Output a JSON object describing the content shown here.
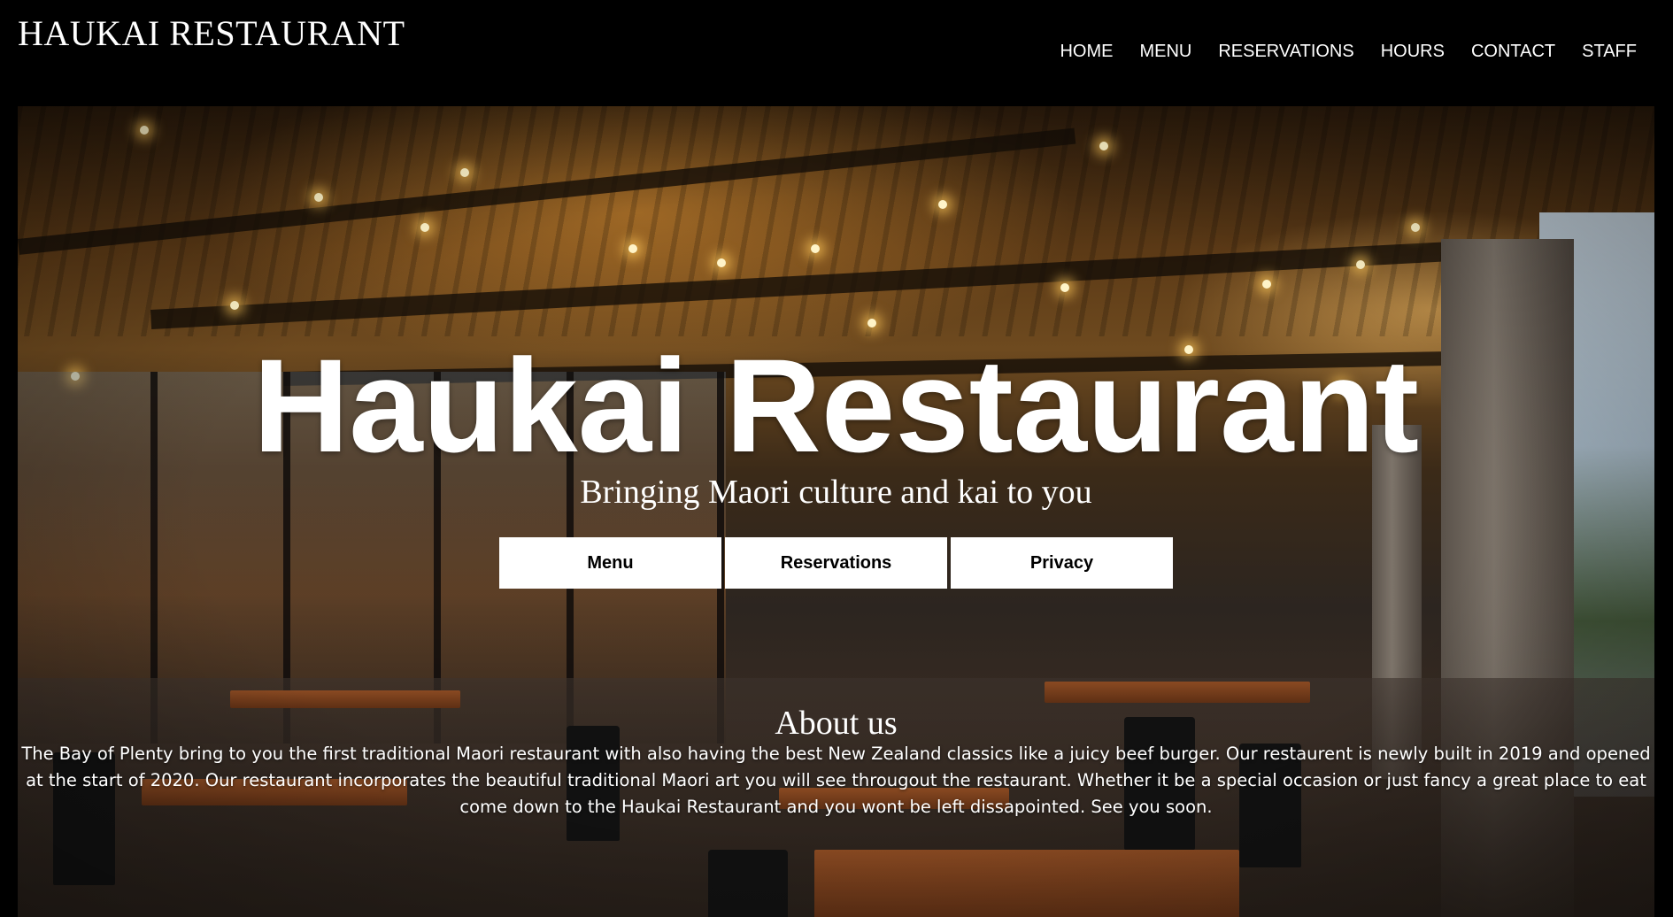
{
  "header": {
    "brand": "HAUKAI RESTAURANT",
    "nav": [
      "HOME",
      "MENU",
      "RESERVATIONS",
      "HOURS",
      "CONTACT",
      "STAFF"
    ]
  },
  "hero": {
    "title": "Haukai Restaurant",
    "subtitle": "Bringing Maori culture and kai to you",
    "buttons": [
      "Menu",
      "Reservations",
      "Privacy"
    ]
  },
  "about": {
    "title": "About us",
    "text": "The Bay of Plenty bring to you the first traditional Maori restaurant with also having the best New Zealand classics like a juicy beef burger. Our restaurent is newly built in 2019 and opened at the start of 2020. Our restaurant incorporates the beautiful traditional Maori art you will see througout the restaurant. Whether it be a special occasion or just fancy a great place to eat come down to the Haukai Restaurant and you wont be left dissapointed. See you soon."
  },
  "colors": {
    "header_bg": "#000000",
    "text": "#ffffff",
    "button_bg": "#ffffff",
    "button_text": "#000000"
  }
}
